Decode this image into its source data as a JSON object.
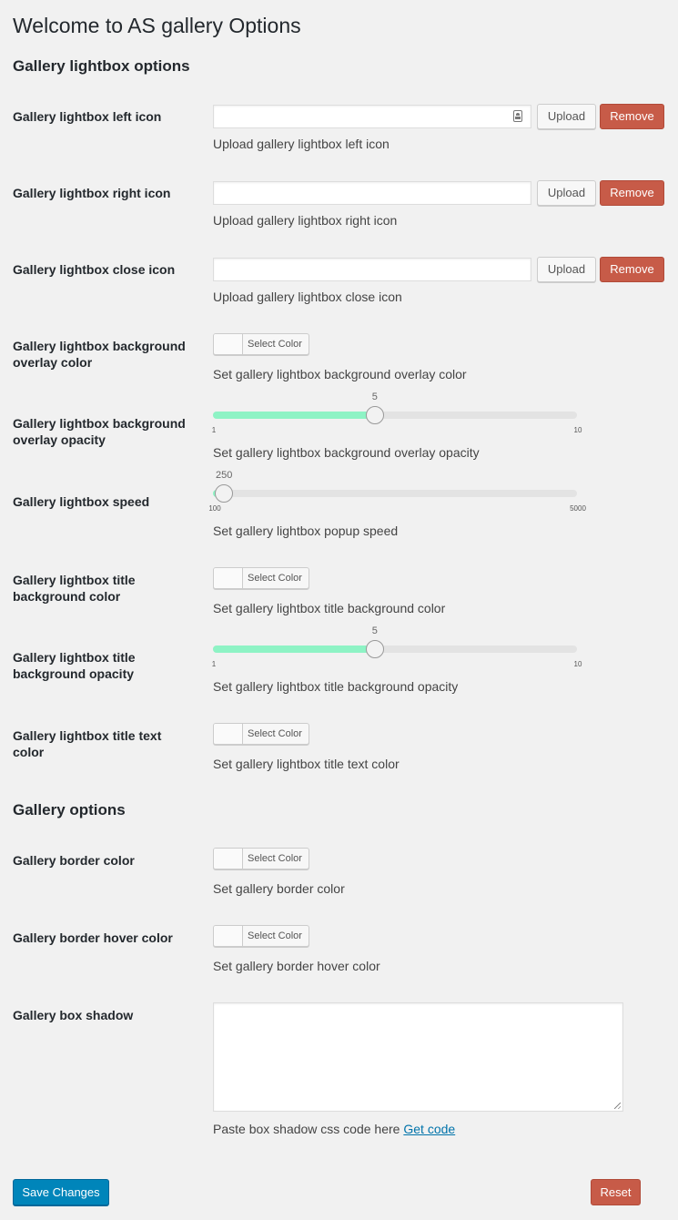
{
  "page": {
    "title": "Welcome to AS gallery Options"
  },
  "sections": {
    "lightbox_title": "Gallery lightbox options",
    "gallery_title": "Gallery options"
  },
  "lightbox": {
    "left_icon": {
      "label": "Gallery lightbox left icon",
      "value": "",
      "upload_label": "Upload",
      "remove_label": "Remove",
      "description": "Upload gallery lightbox left icon"
    },
    "right_icon": {
      "label": "Gallery lightbox right icon",
      "value": "",
      "upload_label": "Upload",
      "remove_label": "Remove",
      "description": "Upload gallery lightbox right icon"
    },
    "close_icon": {
      "label": "Gallery lightbox close icon",
      "value": "",
      "upload_label": "Upload",
      "remove_label": "Remove",
      "description": "Upload gallery lightbox close icon"
    },
    "overlay_color": {
      "label": "Gallery lightbox background overlay color",
      "button_label": "Select Color",
      "description": "Set gallery lightbox background overlay color"
    },
    "overlay_opacity": {
      "label": "Gallery lightbox background overlay opacity",
      "value": 5,
      "min": 1,
      "max": 10,
      "value_label": "5",
      "min_label": "1",
      "max_label": "10",
      "description": "Set gallery lightbox background overlay opacity"
    },
    "speed": {
      "label": "Gallery lightbox speed",
      "value": 250,
      "min": 100,
      "max": 5000,
      "value_label": "250",
      "min_label": "100",
      "max_label": "5000",
      "description": "Set gallery lightbox popup speed"
    },
    "title_bg_color": {
      "label": "Gallery lightbox title background color",
      "button_label": "Select Color",
      "description": "Set gallery lightbox title background color"
    },
    "title_bg_opacity": {
      "label": "Gallery lightbox title background opacity",
      "value": 5,
      "min": 1,
      "max": 10,
      "value_label": "5",
      "min_label": "1",
      "max_label": "10",
      "description": "Set gallery lightbox title background opacity"
    },
    "title_text_color": {
      "label": "Gallery lightbox title text color",
      "button_label": "Select Color",
      "description": "Set gallery lightbox title text color"
    }
  },
  "gallery": {
    "border_color": {
      "label": "Gallery border color",
      "button_label": "Select Color",
      "description": "Set gallery border color"
    },
    "border_hover_color": {
      "label": "Gallery border hover color",
      "button_label": "Select Color",
      "description": "Set gallery border hover color"
    },
    "box_shadow": {
      "label": "Gallery box shadow",
      "value": "",
      "description": "Paste box shadow css code here",
      "link_label": "Get code"
    }
  },
  "actions": {
    "save_label": "Save Changes",
    "reset_label": "Reset"
  },
  "colors": {
    "primary_button": "#0085ba",
    "remove_button": "#c75b48",
    "slider_fill": "#8ef3c5",
    "link": "#0073aa"
  }
}
